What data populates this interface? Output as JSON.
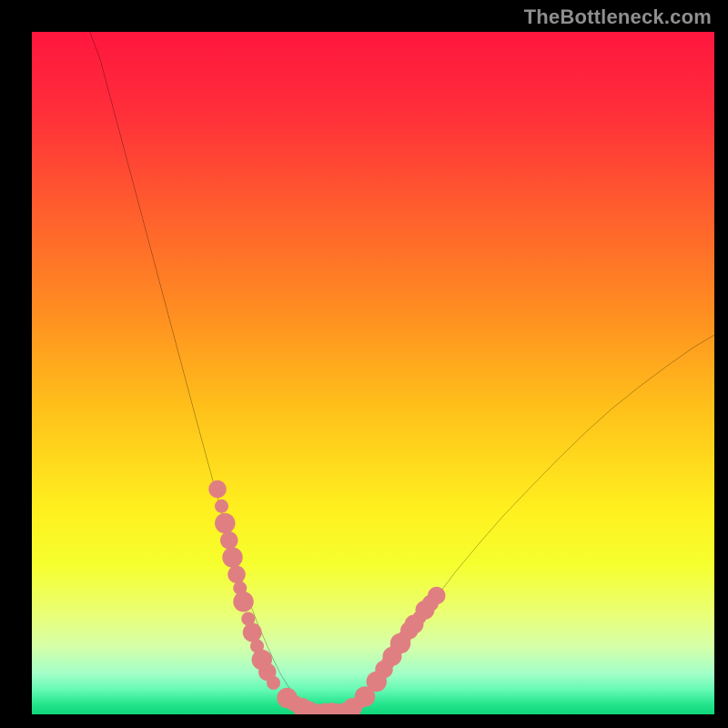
{
  "watermark": "TheBottleneck.com",
  "gradient": {
    "stops": [
      {
        "offset": 0.0,
        "color": "#ff163e"
      },
      {
        "offset": 0.12,
        "color": "#ff2f3a"
      },
      {
        "offset": 0.25,
        "color": "#ff5a2e"
      },
      {
        "offset": 0.4,
        "color": "#ff8a22"
      },
      {
        "offset": 0.55,
        "color": "#ffc01a"
      },
      {
        "offset": 0.7,
        "color": "#fff01f"
      },
      {
        "offset": 0.78,
        "color": "#f6ff2e"
      },
      {
        "offset": 0.85,
        "color": "#eaff72"
      },
      {
        "offset": 0.9,
        "color": "#d6ffa8"
      },
      {
        "offset": 0.94,
        "color": "#a3ffc8"
      },
      {
        "offset": 0.965,
        "color": "#62f9b3"
      },
      {
        "offset": 0.985,
        "color": "#25e58c"
      },
      {
        "offset": 1.0,
        "color": "#0fd67a"
      }
    ]
  },
  "chart_data": {
    "type": "line",
    "title": "",
    "xlabel": "",
    "ylabel": "",
    "xlim": [
      0,
      100
    ],
    "ylim": [
      0,
      100
    ],
    "grid": false,
    "legend": false,
    "series": [
      {
        "name": "bottleneck-curve",
        "x": [
          8.5,
          10,
          12,
          14,
          16,
          18,
          20,
          22,
          24,
          25.5,
          27,
          28.5,
          30,
          31.5,
          33,
          34.5,
          35.5,
          36.5,
          37.5,
          38.5,
          39.5,
          40.5,
          41.5,
          42.3,
          43.2,
          44,
          44.8,
          45.7,
          47,
          48.5,
          50,
          51.5,
          53.5,
          56,
          59,
          62,
          65.5,
          69,
          73,
          77,
          81,
          85,
          89,
          93,
          97,
          100
        ],
        "y": [
          100,
          96,
          88.5,
          81,
          73.5,
          66,
          58.5,
          51,
          43.5,
          38,
          32.5,
          27,
          22,
          17.5,
          13.5,
          10,
          7.8,
          5.8,
          4.2,
          2.9,
          1.9,
          1.2,
          0.7,
          0.4,
          0.25,
          0.2,
          0.25,
          0.45,
          1.1,
          2.4,
          4.2,
          6.4,
          9.2,
          12.7,
          16.8,
          20.8,
          25,
          29,
          33.2,
          37.3,
          41.2,
          44.8,
          48,
          51,
          53.8,
          55.6
        ]
      }
    ],
    "scatter_overlay": {
      "name": "highlight-dots",
      "color": "#e07f82",
      "points": [
        {
          "x": 27.2,
          "y": 33.0,
          "r": 1.3
        },
        {
          "x": 27.8,
          "y": 30.5,
          "r": 1.0
        },
        {
          "x": 28.3,
          "y": 28.0,
          "r": 1.5
        },
        {
          "x": 28.9,
          "y": 25.5,
          "r": 1.3
        },
        {
          "x": 29.4,
          "y": 23.0,
          "r": 1.5
        },
        {
          "x": 30.0,
          "y": 20.5,
          "r": 1.3
        },
        {
          "x": 30.5,
          "y": 18.5,
          "r": 1.0
        },
        {
          "x": 31.0,
          "y": 16.5,
          "r": 1.5
        },
        {
          "x": 31.7,
          "y": 14.0,
          "r": 1.0
        },
        {
          "x": 32.3,
          "y": 12.0,
          "r": 1.4
        },
        {
          "x": 33.0,
          "y": 10.0,
          "r": 1.0
        },
        {
          "x": 33.7,
          "y": 8.0,
          "r": 1.5
        },
        {
          "x": 34.5,
          "y": 6.2,
          "r": 1.3
        },
        {
          "x": 35.4,
          "y": 4.6,
          "r": 1.0
        },
        {
          "x": 37.4,
          "y": 2.4,
          "r": 1.5
        },
        {
          "x": 38.5,
          "y": 1.6,
          "r": 1.2
        },
        {
          "x": 39.6,
          "y": 1.0,
          "r": 1.4
        },
        {
          "x": 40.7,
          "y": 0.6,
          "r": 1.3
        },
        {
          "x": 41.8,
          "y": 0.35,
          "r": 1.2
        },
        {
          "x": 43.0,
          "y": 0.25,
          "r": 1.4
        },
        {
          "x": 44.0,
          "y": 0.2,
          "r": 1.5
        },
        {
          "x": 45.0,
          "y": 0.3,
          "r": 1.3
        },
        {
          "x": 46.0,
          "y": 0.55,
          "r": 1.2
        },
        {
          "x": 47.0,
          "y": 1.0,
          "r": 1.4
        },
        {
          "x": 48.0,
          "y": 1.8,
          "r": 1.0
        },
        {
          "x": 48.8,
          "y": 2.6,
          "r": 1.5
        },
        {
          "x": 50.5,
          "y": 4.8,
          "r": 1.5
        },
        {
          "x": 51.0,
          "y": 5.6,
          "r": 1.0
        },
        {
          "x": 51.6,
          "y": 6.6,
          "r": 1.3
        },
        {
          "x": 52.2,
          "y": 7.6,
          "r": 1.0
        },
        {
          "x": 52.8,
          "y": 8.5,
          "r": 1.4
        },
        {
          "x": 53.4,
          "y": 9.5,
          "r": 1.0
        },
        {
          "x": 54.0,
          "y": 10.4,
          "r": 1.5
        },
        {
          "x": 54.6,
          "y": 11.3,
          "r": 1.0
        },
        {
          "x": 55.3,
          "y": 12.3,
          "r": 1.3
        },
        {
          "x": 56.0,
          "y": 13.2,
          "r": 1.4
        },
        {
          "x": 56.8,
          "y": 14.2,
          "r": 1.0
        },
        {
          "x": 57.6,
          "y": 15.3,
          "r": 1.4
        },
        {
          "x": 58.4,
          "y": 16.3,
          "r": 1.2
        },
        {
          "x": 59.3,
          "y": 17.4,
          "r": 1.3
        }
      ]
    }
  }
}
